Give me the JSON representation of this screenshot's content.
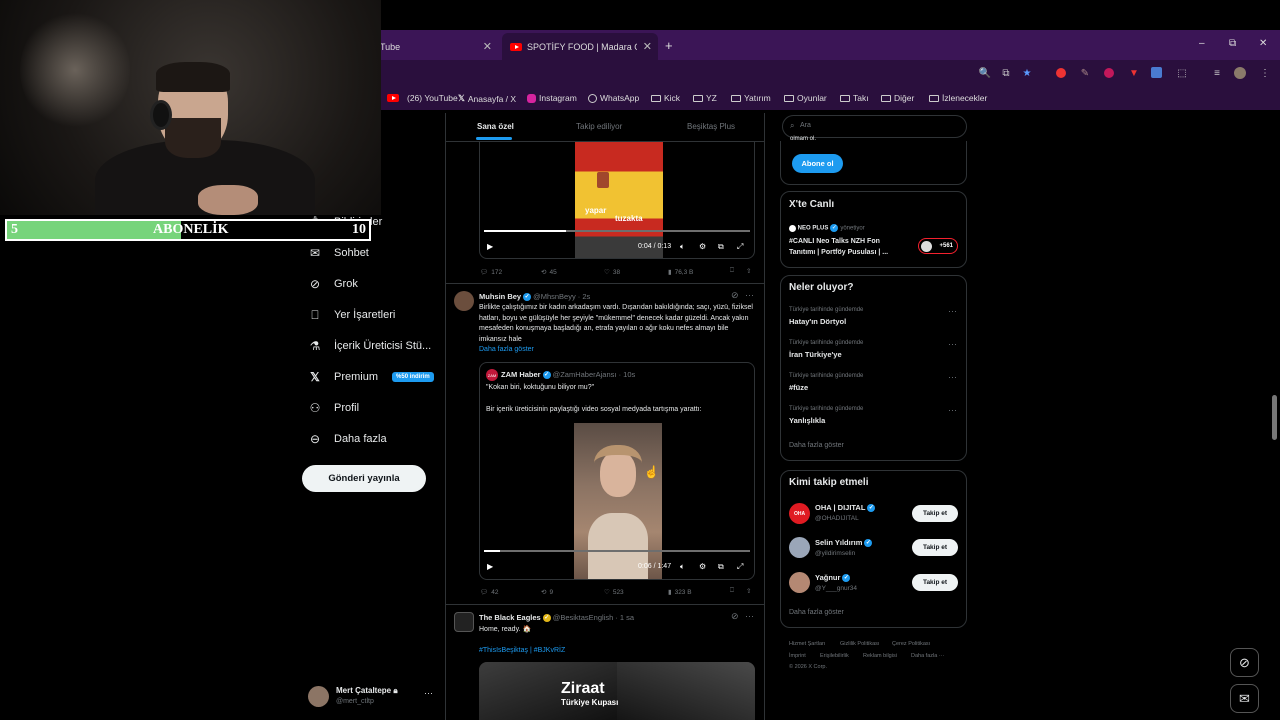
{
  "browser": {
    "tabs": [
      {
        "label": "Tube"
      },
      {
        "label": "SPOTİFY FOOD | Madara Oldu!"
      }
    ],
    "new_tab": "+",
    "window_controls": {
      "minimize": "–",
      "maximize": "⧉",
      "close": "✕"
    },
    "bookmarks": [
      {
        "label": "(26) YouTube",
        "icon": "youtube-icon"
      },
      {
        "label": "Anasayfa / X",
        "icon": "x-icon"
      },
      {
        "label": "Instagram",
        "icon": "instagram-icon"
      },
      {
        "label": "WhatsApp",
        "icon": "whatsapp-icon"
      },
      {
        "label": "Kick",
        "icon": "folder-icon"
      },
      {
        "label": "YZ",
        "icon": "folder-icon"
      },
      {
        "label": "Yatırım",
        "icon": "folder-icon"
      },
      {
        "label": "Oyunlar",
        "icon": "folder-icon"
      },
      {
        "label": "Takı",
        "icon": "folder-icon"
      },
      {
        "label": "Diğer",
        "icon": "folder-icon"
      },
      {
        "label": "İzlenecekler",
        "icon": "folder-icon"
      }
    ]
  },
  "overlay": {
    "sub_start": "5",
    "sub_label": "ABONELİK",
    "sub_goal": "10",
    "sub_progress": 0.48
  },
  "nav": {
    "items": [
      {
        "label": "Bildirimler",
        "icon": "bell-icon"
      },
      {
        "label": "Sohbet",
        "icon": "mail-icon"
      },
      {
        "label": "Grok",
        "icon": "grok-icon"
      },
      {
        "label": "Yer İşaretleri",
        "icon": "bookmark-icon"
      },
      {
        "label": "İçerik Üreticisi Stü...",
        "icon": "flask-icon"
      },
      {
        "label": "Premium",
        "icon": "x-logo-icon",
        "badge": "%50 indirim"
      },
      {
        "label": "Profil",
        "icon": "person-icon"
      },
      {
        "label": "Daha fazla",
        "icon": "more-circle-icon"
      }
    ],
    "post_button": "Gönderi yayınla",
    "user": {
      "name": "Mert Çataltepe",
      "handle": "@mert_ctltp"
    }
  },
  "feed": {
    "tabs": [
      "Sana özel",
      "Takip ediliyor",
      "Beşiktaş Plus"
    ],
    "post1": {
      "video_caption": "yapar",
      "video_caption2": "tuzakta",
      "time": "0:04 / 0:13",
      "progress": 0.31,
      "replies": "172",
      "reposts": "45",
      "likes": "38",
      "views": "76,3 B"
    },
    "post2": {
      "name": "Muhsin Bey",
      "handle": "@MhsnBeyy · 2s",
      "text": "Birlikte çalıştığımız bir kadın arkadaşım vardı. Dışarıdan bakıldığında; saçı, yüzü, fiziksel hatları, boyu ve gülüşüyle her şeyiyle \"mükemmel\" denecek kadar güzeldi. Ancak yakın mesafeden konuşmaya başladığı an, etrafa yayılan o ağır koku nefes almayı bile imkansız hale",
      "show_more": "Daha fazla göster",
      "quote": {
        "name": "ZAM Haber",
        "handle": "@ZamHaberAjansı · 10s",
        "line1": "\"Kokan biri, koktuğunu biliyor mu?\"",
        "line2": "Bir içerik üreticisinin paylaştığı video sosyal medyada tartışma yarattı:",
        "time": "0:06 / 1:47",
        "progress": 0.06
      },
      "replies": "42",
      "reposts": "9",
      "likes": "523",
      "views": "323 B"
    },
    "post3": {
      "name": "The Black Eagles",
      "handle": "@BesiktasEnglish · 1 sa",
      "text": "Home, ready. 🏠",
      "hashtags": "#ThisIsBeşiktaş | #BJKvRİZ",
      "image_text1": "Ziraat",
      "image_text2": "Türkiye Kupası"
    }
  },
  "sidebar": {
    "search_placeholder": "Ara",
    "premium_tail": "olmam ol.",
    "subscribe": "Abone ol",
    "live": {
      "title": "X'te Canlı",
      "host": "NEO PLUS",
      "host_role": "yönetiyor",
      "text1": "#CANLI Neo Talks NZH Fon",
      "text2": "Tanıtımı | Portföy Pusulası | ...",
      "listeners": "+561"
    },
    "trends": {
      "title": "Neler oluyor?",
      "items": [
        {
          "context": "Türkiye tarihinde gündemde",
          "topic": "Hatay'ın Dörtyol"
        },
        {
          "context": "Türkiye tarihinde gündemde",
          "topic": "İran Türkiye'ye"
        },
        {
          "context": "Türkiye tarihinde gündemde",
          "topic": "#füze"
        },
        {
          "context": "Türkiye tarihinde gündemde",
          "topic": "Yanlışlıkla"
        }
      ],
      "show_more": "Daha fazla göster"
    },
    "who_to_follow": {
      "title": "Kimi takip etmeli",
      "items": [
        {
          "name": "OHA | DIJITAL",
          "handle": "@OHADIJITAL",
          "button": "Takip et"
        },
        {
          "name": "Selin Yıldırım",
          "handle": "@yildirimselin",
          "button": "Takip et"
        },
        {
          "name": "Yağnur",
          "handle": "@Y___gnur34",
          "button": "Takip et"
        }
      ],
      "show_more": "Daha fazla göster"
    },
    "footer": {
      "row1": [
        "Hizmet Şartları",
        "Gizlilik Politikası",
        "Çerez Politikası"
      ],
      "row2": [
        "İmprint",
        "Erişilebilirlik",
        "Reklam bilgisi",
        "Daha fazla ···"
      ],
      "copyright": "© 2026 X Corp."
    }
  },
  "colors": {
    "accent": "#1d9bf0",
    "tabstrip": "#3b1556",
    "toolbar": "#2a0f3d",
    "sub_fill": "#77d47b"
  }
}
